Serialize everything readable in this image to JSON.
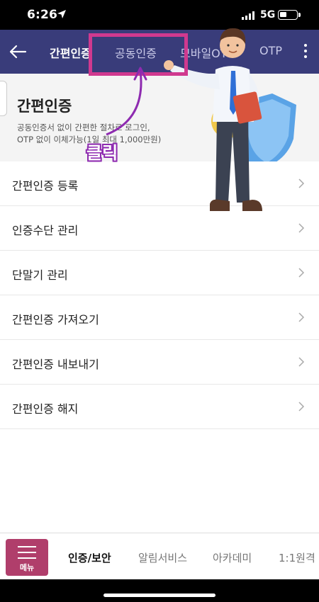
{
  "status_bar": {
    "time": "6:26",
    "network": "5G"
  },
  "header": {
    "tabs": [
      {
        "label": "간편인증",
        "active": true
      },
      {
        "label": "공동인증",
        "active": false
      },
      {
        "label": "모바일OTP",
        "active": false
      },
      {
        "label": "OTP",
        "active": false
      }
    ]
  },
  "hero": {
    "title": "간편인증",
    "description_line1": "공동인증서 없이 간편한 절차로 로그인,",
    "description_line2": "OTP 없이 이체가능(1일 최대 1,000만원)"
  },
  "menu_items": [
    {
      "label": "간편인증 등록"
    },
    {
      "label": "인증수단 관리"
    },
    {
      "label": "단말기 관리"
    },
    {
      "label": "간편인증 가져오기"
    },
    {
      "label": "간편인증 내보내기"
    },
    {
      "label": "간편인증 해지"
    }
  ],
  "bottom_nav": {
    "menu_label": "메뉴",
    "tabs": [
      {
        "label": "인증/보안",
        "active": true
      },
      {
        "label": "알림서비스",
        "active": false
      },
      {
        "label": "아카데미",
        "active": false
      },
      {
        "label": "1:1원격",
        "active": false
      }
    ]
  },
  "annotation": {
    "label": "클릭"
  },
  "colors": {
    "header_bg": "#393c7a",
    "menu_button_bg": "#b03e6b",
    "highlight_border": "#d0398f",
    "annotation_purple": "#8e2bb0"
  },
  "icons": [
    "location-arrow-icon",
    "signal-icon",
    "battery-icon",
    "back-arrow-icon",
    "more-vertical-icon",
    "shield-icon",
    "chevron-right-icon",
    "hamburger-icon"
  ]
}
